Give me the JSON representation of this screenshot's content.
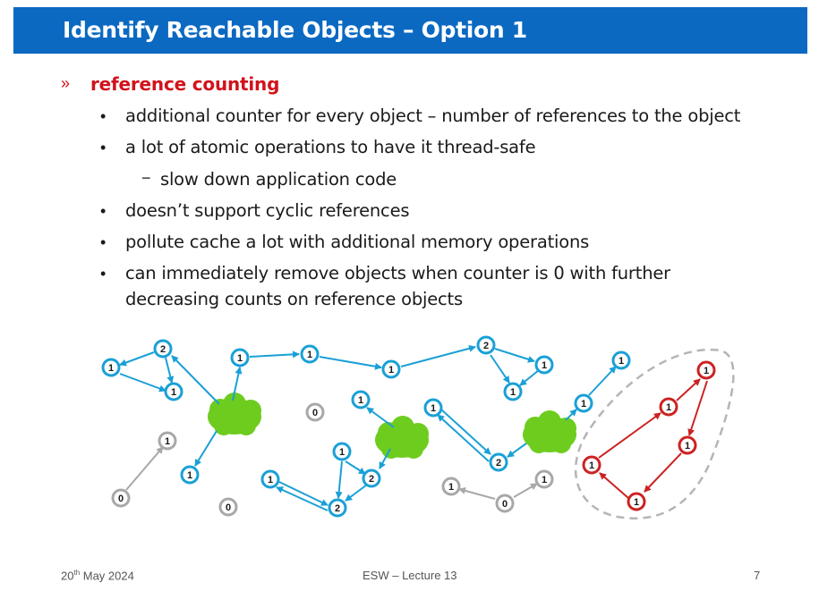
{
  "title": "Identify Reachable Objects – Option 1",
  "heading": {
    "marker": "»",
    "text": "reference counting"
  },
  "bullets": [
    {
      "text": "additional counter for every object – number of references to the object"
    },
    {
      "text": "a lot of atomic operations to have it thread-safe",
      "sub": [
        "slow down application code"
      ]
    },
    {
      "text": "doesn’t support cyclic references"
    },
    {
      "text": "pollute cache a lot with additional memory operations"
    },
    {
      "text": "can immediately remove objects when counter is 0 with further",
      "cont": "decreasing counts on reference objects"
    }
  ],
  "markers": {
    "bullet": "•",
    "dash": "−"
  },
  "colors": {
    "title_bg": "#0b69c1",
    "highlight": "#d1131b",
    "node_blue": "#1aa0d6",
    "node_gray": "#a8a8a8",
    "node_red": "#cc2222",
    "cloud": "#6ecc1e"
  },
  "diagram": {
    "nodes": [
      {
        "id": "b1",
        "label": "1",
        "color": "blue"
      },
      {
        "id": "b2",
        "label": "2",
        "color": "blue"
      },
      {
        "id": "b3",
        "label": "1",
        "color": "blue"
      },
      {
        "id": "b4",
        "label": "1",
        "color": "blue"
      },
      {
        "id": "b5",
        "label": "1",
        "color": "blue"
      },
      {
        "id": "b6",
        "label": "1",
        "color": "blue"
      },
      {
        "id": "b7",
        "label": "2",
        "color": "blue"
      },
      {
        "id": "b8",
        "label": "1",
        "color": "blue"
      },
      {
        "id": "b9",
        "label": "1",
        "color": "blue"
      },
      {
        "id": "b10",
        "label": "1",
        "color": "blue"
      },
      {
        "id": "b11",
        "label": "1",
        "color": "blue"
      },
      {
        "id": "b12",
        "label": "1",
        "color": "blue"
      },
      {
        "id": "b13",
        "label": "1",
        "color": "blue"
      },
      {
        "id": "b14",
        "label": "2",
        "color": "blue"
      },
      {
        "id": "b15",
        "label": "1",
        "color": "blue"
      },
      {
        "id": "b16",
        "label": "1",
        "color": "blue"
      },
      {
        "id": "b17",
        "label": "1",
        "color": "blue"
      },
      {
        "id": "b18",
        "label": "2",
        "color": "blue"
      },
      {
        "id": "b19",
        "label": "2",
        "color": "blue"
      },
      {
        "id": "g1",
        "label": "0",
        "color": "gray"
      },
      {
        "id": "g2",
        "label": "1",
        "color": "gray"
      },
      {
        "id": "g3",
        "label": "0",
        "color": "gray"
      },
      {
        "id": "g4",
        "label": "0",
        "color": "gray"
      },
      {
        "id": "g5",
        "label": "1",
        "color": "gray"
      },
      {
        "id": "g6",
        "label": "0",
        "color": "gray"
      },
      {
        "id": "g7",
        "label": "1",
        "color": "gray"
      },
      {
        "id": "r1",
        "label": "1",
        "color": "red"
      },
      {
        "id": "r2",
        "label": "1",
        "color": "red"
      },
      {
        "id": "r3",
        "label": "1",
        "color": "red"
      },
      {
        "id": "r4",
        "label": "1",
        "color": "red"
      },
      {
        "id": "r5",
        "label": "1",
        "color": "red"
      }
    ],
    "edges": [
      {
        "from": "b2",
        "to": "b1"
      },
      {
        "from": "b1",
        "to": "b3"
      },
      {
        "from": "b2",
        "to": "b3"
      },
      {
        "from": "c1",
        "to": "b2"
      },
      {
        "from": "c1",
        "to": "b4"
      },
      {
        "from": "c1",
        "to": "b5"
      },
      {
        "from": "b4",
        "to": "b6"
      },
      {
        "from": "b6",
        "to": "b8"
      },
      {
        "from": "b8",
        "to": "b7"
      },
      {
        "from": "b7",
        "to": "b9"
      },
      {
        "from": "b7",
        "to": "b10"
      },
      {
        "from": "b10",
        "to": "b9"
      },
      {
        "from": "c2",
        "to": "b11"
      },
      {
        "from": "c2",
        "to": "b15"
      },
      {
        "from": "b16",
        "to": "b19"
      },
      {
        "from": "b17",
        "to": "b19"
      },
      {
        "from": "b17",
        "to": "b18"
      },
      {
        "from": "b19",
        "to": "b17"
      },
      {
        "from": "b15",
        "to": "b18"
      },
      {
        "from": "b12",
        "to": "b14"
      },
      {
        "from": "b14",
        "to": "b12"
      },
      {
        "from": "c3",
        "to": "b14"
      },
      {
        "from": "c3",
        "to": "b13"
      },
      {
        "from": "b13",
        "to": "b4x"
      },
      {
        "from": "g1",
        "to": "g2"
      },
      {
        "from": "g6",
        "to": "g5"
      },
      {
        "from": "g6",
        "to": "g7"
      },
      {
        "from": "r1",
        "to": "r2"
      },
      {
        "from": "r2",
        "to": "r3"
      },
      {
        "from": "r3",
        "to": "r4"
      },
      {
        "from": "r4",
        "to": "r5"
      },
      {
        "from": "r5",
        "to": "r1"
      }
    ]
  },
  "footer": {
    "date_day": "20",
    "date_suffix": "th",
    "date_rest": " May 2024",
    "center": "ESW – Lecture 13",
    "page": "7"
  }
}
